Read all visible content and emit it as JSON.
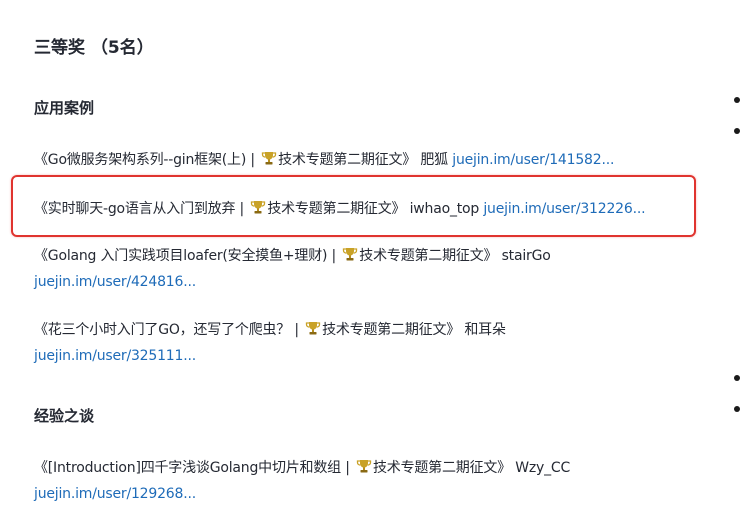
{
  "section_title": "三等奖 （5名）",
  "categories": [
    {
      "heading": "应用案例",
      "entries": [
        {
          "title": "《Go微服务架构系列--gin框架(上) | ",
          "tag": "技术专题第二期征文》",
          "author": "肥狐",
          "link": "juejin.im/user/141582..."
        },
        {
          "title": "《实时聊天-go语言从入门到放弃 | ",
          "tag": "技术专题第二期征文》",
          "author": "iwhao_top",
          "link": "juejin.im/user/312226..."
        },
        {
          "title": "《Golang 入门实践项目loafer(安全摸鱼+理财) | ",
          "tag": "技术专题第二期征文》",
          "author": "stairGo",
          "link": "juejin.im/user/424816..."
        },
        {
          "title": "《花三个小时入门了GO，还写了个爬虫？ | ",
          "tag": "技术专题第二期征文》",
          "author": "和耳朵",
          "link": "juejin.im/user/325111..."
        }
      ]
    },
    {
      "heading": "经验之谈",
      "entries": [
        {
          "title": "《[Introduction]四千字浅谈Golang中切片和数组 | ",
          "tag": "技术专题第二期征文》",
          "author": "Wzy_CC",
          "link": "juejin.im/user/129268..."
        }
      ]
    }
  ],
  "icons": {
    "trophy": "trophy-icon"
  },
  "colors": {
    "link": "#1e6bb8",
    "highlight": "#e0342f",
    "text": "#252933",
    "trophy": "#c9a227"
  }
}
